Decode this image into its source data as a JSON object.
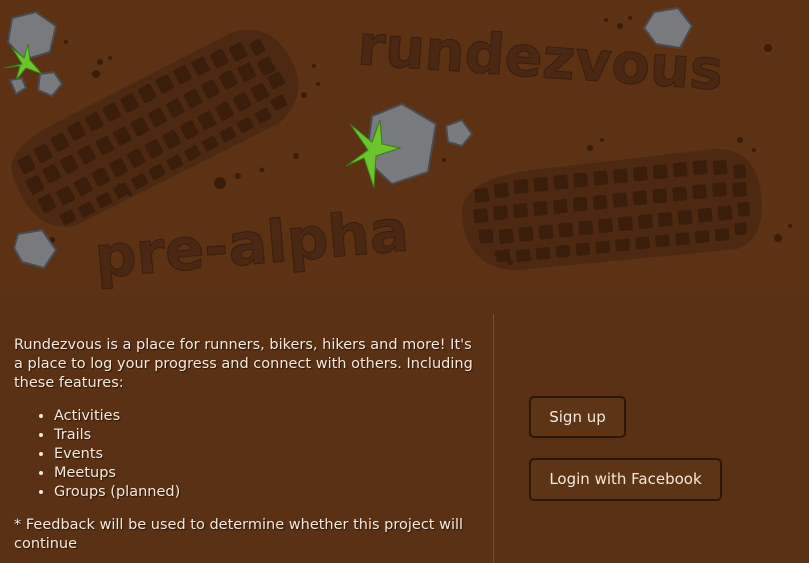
{
  "logo": {
    "title": "rundezvous",
    "tagline": "pre-alpha"
  },
  "intro": {
    "description": "Rundezvous is a place for runners, bikers, hikers and more! It's a place to log your progress and connect with others. Including these features:",
    "features": [
      "Activities",
      "Trails",
      "Events",
      "Meetups",
      "Groups (planned)"
    ],
    "note": "* Feedback will be used to determine whether this project will continue"
  },
  "actions": {
    "signup_label": "Sign up",
    "facebook_label": "Login with Facebook"
  },
  "icons": {
    "leaf": "green-star-leaf-icon",
    "rock": "gray-rock-icon",
    "footprint": "shoe-footprint-icon"
  },
  "colors": {
    "background": "#5a3114",
    "tread": "#3c1f0c",
    "rock": "#7a7c80",
    "leaf": "#6cc52c",
    "text": "#f4e9dc"
  }
}
